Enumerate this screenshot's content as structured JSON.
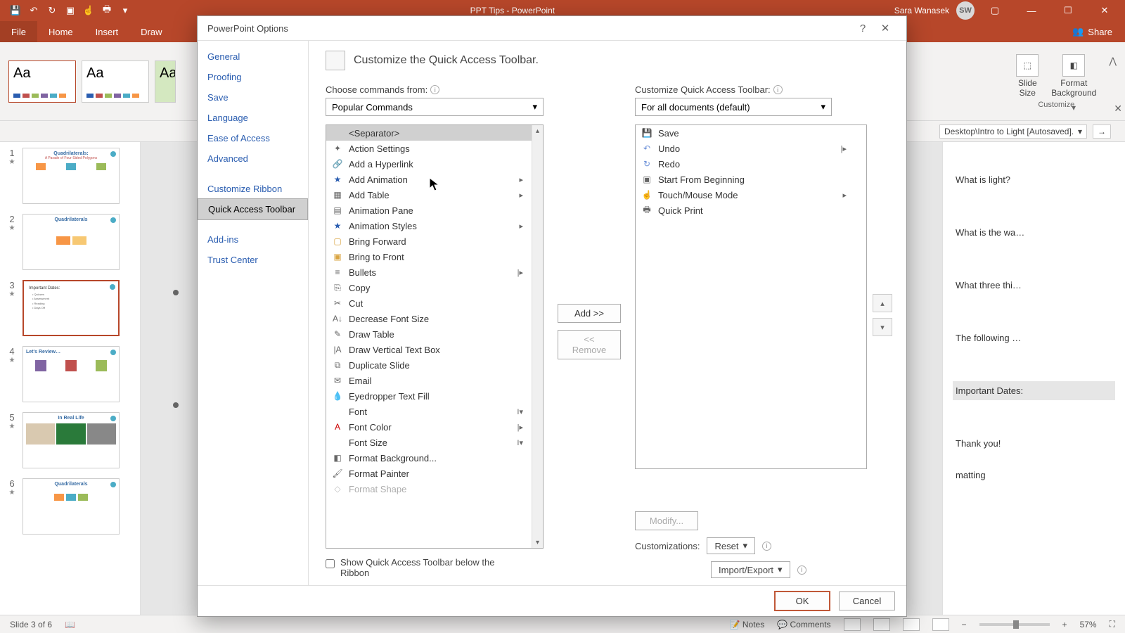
{
  "titlebar": {
    "doc_title": "PPT Tips - PowerPoint",
    "user_name": "Sara Wanasek",
    "user_initials": "SW"
  },
  "ribbon": {
    "tabs": {
      "file": "File",
      "home": "Home",
      "insert": "Insert",
      "draw": "Draw"
    },
    "share": "Share",
    "slide_size": "Slide\nSize",
    "format_bg": "Format\nBackground",
    "group_customize": "Customize"
  },
  "subbar": {
    "path": "Desktop\\Intro to Light [Autosaved].",
    "browse": "Browse"
  },
  "slides": {
    "s1": "1",
    "s2": "2",
    "s3": "3",
    "s4": "4",
    "s5": "5",
    "s6": "6",
    "t1": "Quadrilaterals:",
    "t1b": "A Parade of Four-Sided Polygons",
    "t2": "Quadrilaterals",
    "t3": "Important Dates:",
    "t4": "Let's Review…",
    "t5": "In Real Life",
    "t6": "Quadrilaterals"
  },
  "rightpane": {
    "i1": "What is light?",
    "i2": "What is the wa…",
    "i3": "What three thi…",
    "i4": "The following …",
    "i5": "Important Dates:",
    "i6": "Thank you!",
    "i7": "matting"
  },
  "statusbar": {
    "slide_info": "Slide 3 of 6",
    "notes": "Notes",
    "comments": "Comments",
    "zoom": "57%"
  },
  "dialog": {
    "title": "PowerPoint Options",
    "nav": {
      "general": "General",
      "proofing": "Proofing",
      "save": "Save",
      "language": "Language",
      "ease": "Ease of Access",
      "advanced": "Advanced",
      "customize_ribbon": "Customize Ribbon",
      "qat": "Quick Access Toolbar",
      "addins": "Add-ins",
      "trust": "Trust Center"
    },
    "heading": "Customize the Quick Access Toolbar.",
    "choose_label": "Choose commands from:",
    "choose_value": "Popular Commands",
    "qat_label": "Customize Quick Access Toolbar:",
    "qat_value": "For all documents (default)",
    "left_list": {
      "separator": "<Separator>",
      "action_settings": "Action Settings",
      "add_hyperlink": "Add a Hyperlink",
      "add_animation": "Add Animation",
      "add_table": "Add Table",
      "animation_pane": "Animation Pane",
      "animation_styles": "Animation Styles",
      "bring_forward": "Bring Forward",
      "bring_front": "Bring to Front",
      "bullets": "Bullets",
      "copy": "Copy",
      "cut": "Cut",
      "decrease_font": "Decrease Font Size",
      "draw_table": "Draw Table",
      "draw_vtb": "Draw Vertical Text Box",
      "duplicate_slide": "Duplicate Slide",
      "email": "Email",
      "eyedropper": "Eyedropper Text Fill",
      "font": "Font",
      "font_color": "Font Color",
      "font_size": "Font Size",
      "format_bg": "Format Background...",
      "format_painter": "Format Painter",
      "format_shape": "Format Shape"
    },
    "right_list": {
      "save": "Save",
      "undo": "Undo",
      "redo": "Redo",
      "start_beginning": "Start From Beginning",
      "touch_mouse": "Touch/Mouse Mode",
      "quick_print": "Quick Print"
    },
    "add_btn": "Add >>",
    "remove_btn": "<< Remove",
    "modify_btn": "Modify...",
    "below_ribbon": "Show Quick Access Toolbar below the Ribbon",
    "customizations": "Customizations:",
    "reset": "Reset",
    "import_export": "Import/Export",
    "ok": "OK",
    "cancel": "Cancel"
  }
}
